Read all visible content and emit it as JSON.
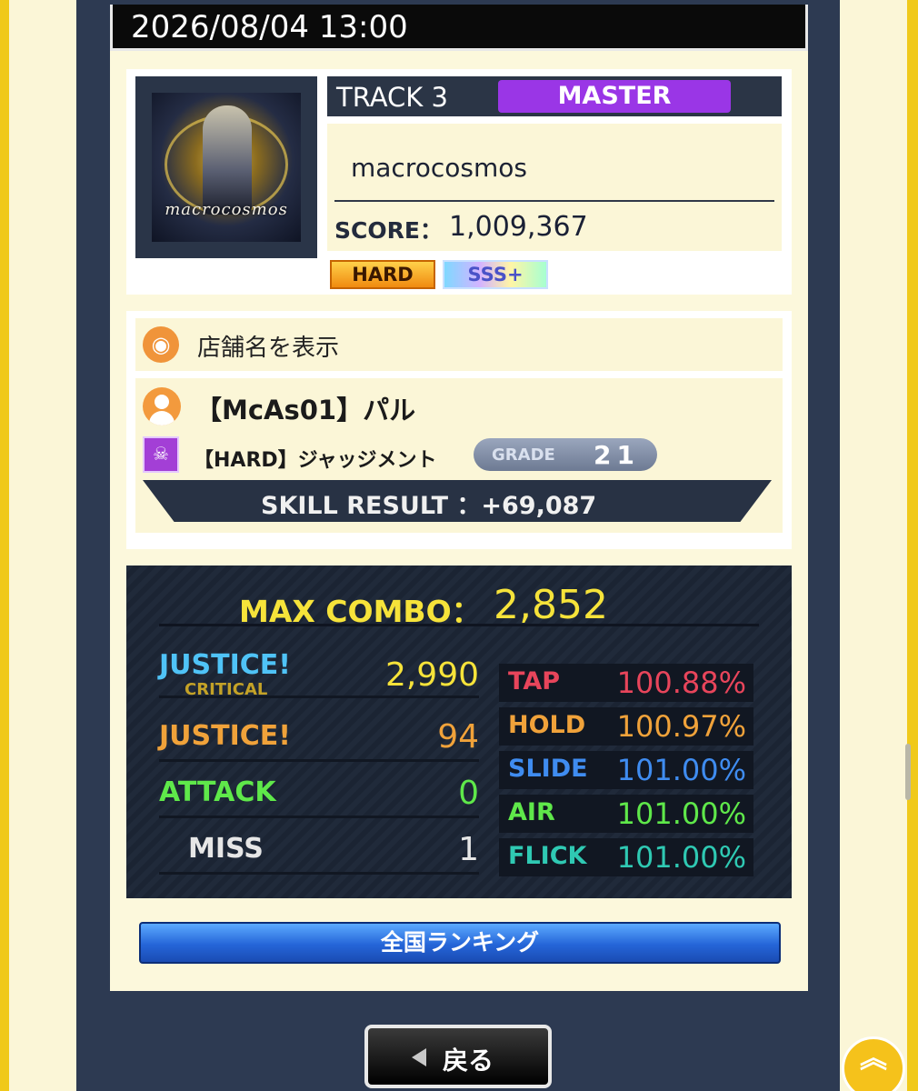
{
  "header": {
    "datetime": "2026/08/04 13:00"
  },
  "song": {
    "track": "TRACK 3",
    "difficulty": "MASTER",
    "difficulty_color": "#9a36e6",
    "jacket_text": "macrocosmos",
    "title": "macrocosmos",
    "score_label": "SCORE：",
    "score": "1,009,367",
    "badges": [
      "HARD",
      "SSS+"
    ]
  },
  "store": {
    "label": "店舗名を表示",
    "icon": "store-icon"
  },
  "player": {
    "name": "【McAs01】パル",
    "skill": "【HARD】ジャッジメント",
    "skill_icon_text": "HARD",
    "grade_label": "GRADE",
    "grade_value": "21",
    "skill_result": "SKILL RESULT ：+69,087"
  },
  "combo": {
    "label": "MAX COMBO：",
    "value": "2,852"
  },
  "judgements": [
    {
      "label": "JUSTICE!",
      "sub": "CRITICAL",
      "value": "2,990",
      "color": "#4fc3f7"
    },
    {
      "label": "JUSTICE!",
      "sub": "",
      "value": "94",
      "color": "#f0a23a"
    },
    {
      "label": "ATTACK",
      "sub": "",
      "value": "0",
      "color": "#5fe84a"
    },
    {
      "label": "MISS",
      "sub": "",
      "value": "1",
      "color": "#e6e6e6"
    }
  ],
  "rates": [
    {
      "label": "TAP",
      "value": "100.88%",
      "color": "#e8455b"
    },
    {
      "label": "HOLD",
      "value": "100.97%",
      "color": "#f0a23a"
    },
    {
      "label": "SLIDE",
      "value": "101.00%",
      "color": "#3f8cf0"
    },
    {
      "label": "AIR",
      "value": "101.00%",
      "color": "#5fe84a"
    },
    {
      "label": "FLICK",
      "value": "101.00%",
      "color": "#2fc9b3"
    }
  ],
  "buttons": {
    "ranking": "全国ランキング",
    "back": "戻る"
  }
}
